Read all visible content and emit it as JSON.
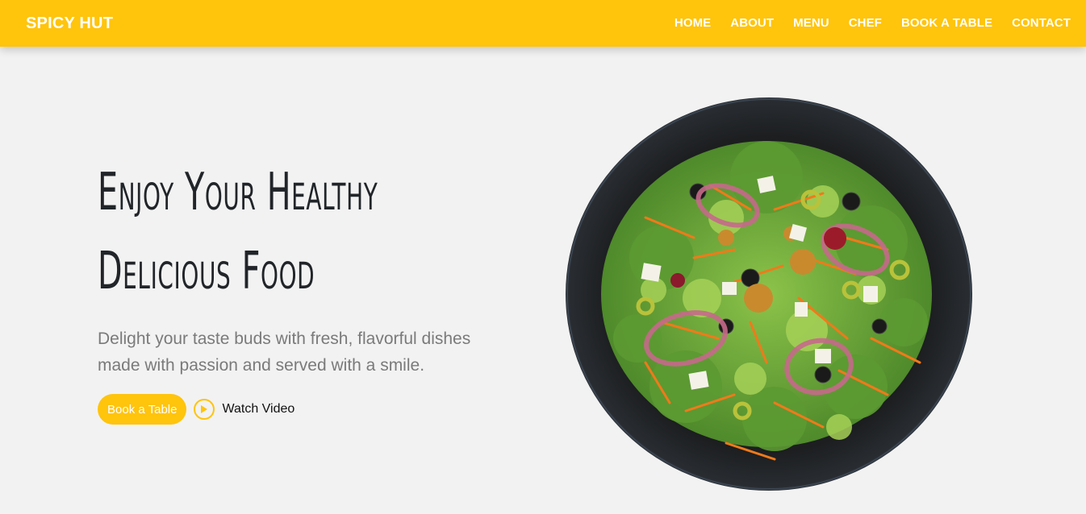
{
  "header": {
    "brand": "SPICY HUT",
    "nav": [
      {
        "label": "HOME"
      },
      {
        "label": "ABOUT"
      },
      {
        "label": "MENU"
      },
      {
        "label": "CHEF"
      },
      {
        "label": "BOOK A TABLE"
      },
      {
        "label": "CONTACT"
      }
    ]
  },
  "hero": {
    "title_line1": "Enjoy Your Healthy",
    "title_line2": "Delicious Food",
    "description": "Delight your taste buds with fresh, flavorful dishes made with passion and served with a smile.",
    "book_button": "Book a Table",
    "watch_video": "Watch Video",
    "image_icon": "salad-plate-image"
  },
  "colors": {
    "accent": "#ffc40c",
    "background": "#f2f2f2",
    "heading": "#212529",
    "muted_text": "#7a7a7a"
  }
}
